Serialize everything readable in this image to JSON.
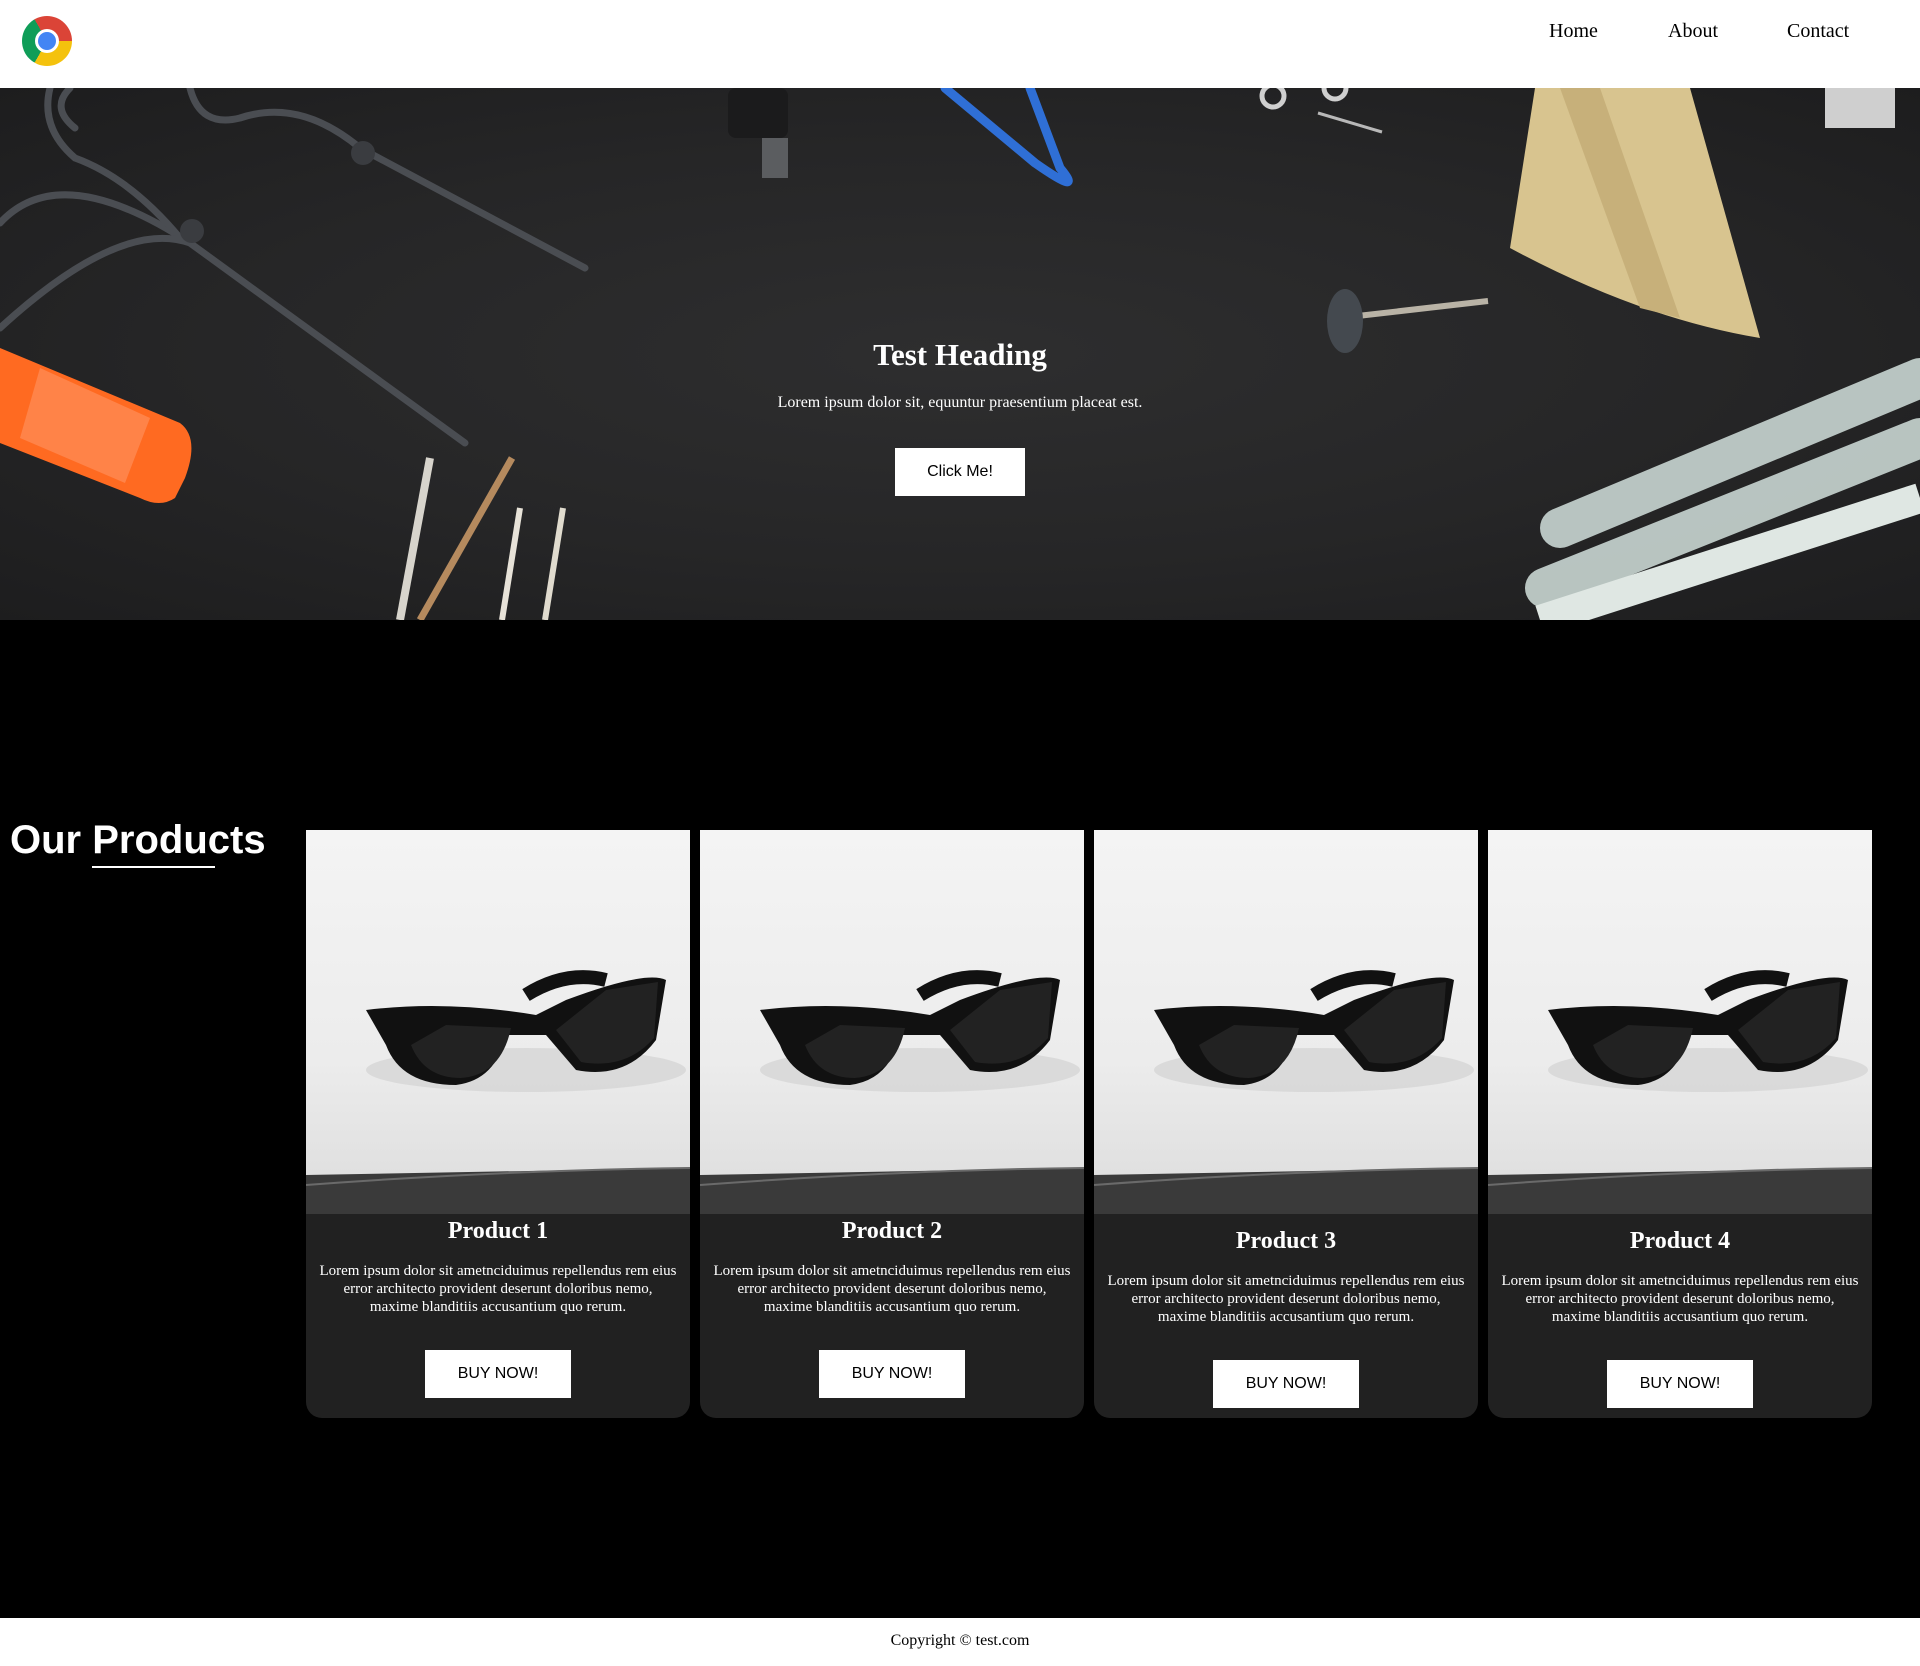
{
  "header": {
    "logo_icon": "chrome-logo-icon",
    "nav": [
      {
        "label": "Home"
      },
      {
        "label": "About"
      },
      {
        "label": "Contact"
      }
    ]
  },
  "hero": {
    "heading": "Test Heading",
    "text": "Lorem ipsum dolor sit, equuntur praesentium placeat est.",
    "button_label": "Click Me!"
  },
  "products": {
    "title_part1": "Our ",
    "title_part2": "Products",
    "items": [
      {
        "title": "Product 1",
        "description": "Lorem ipsum dolor sit ametnciduimus repellendus rem eius error architecto provident deserunt doloribus nemo, maxime blanditiis accusantium quo rerum.",
        "button_label": "BUY NOW!"
      },
      {
        "title": "Product 2",
        "description": "Lorem ipsum dolor sit ametnciduimus repellendus rem eius error architecto provident deserunt doloribus nemo, maxime blanditiis accusantium quo rerum.",
        "button_label": "BUY NOW!"
      },
      {
        "title": "Product 3",
        "description": "Lorem ipsum dolor sit ametnciduimus repellendus rem eius error architecto provident deserunt doloribus nemo, maxime blanditiis accusantium quo rerum.",
        "button_label": "BUY NOW!"
      },
      {
        "title": "Product 4",
        "description": "Lorem ipsum dolor sit ametnciduimus repellendus rem eius error architecto provident deserunt doloribus nemo, maxime blanditiis accusantium quo rerum.",
        "button_label": "BUY NOW!"
      }
    ]
  },
  "footer": {
    "text": "Copyright © test.com"
  },
  "colors": {
    "header_bg": "#ffffff",
    "hero_bg": "#262627",
    "page_bg": "#000000",
    "card_bg": "#212121",
    "button_bg": "#ffffff"
  }
}
